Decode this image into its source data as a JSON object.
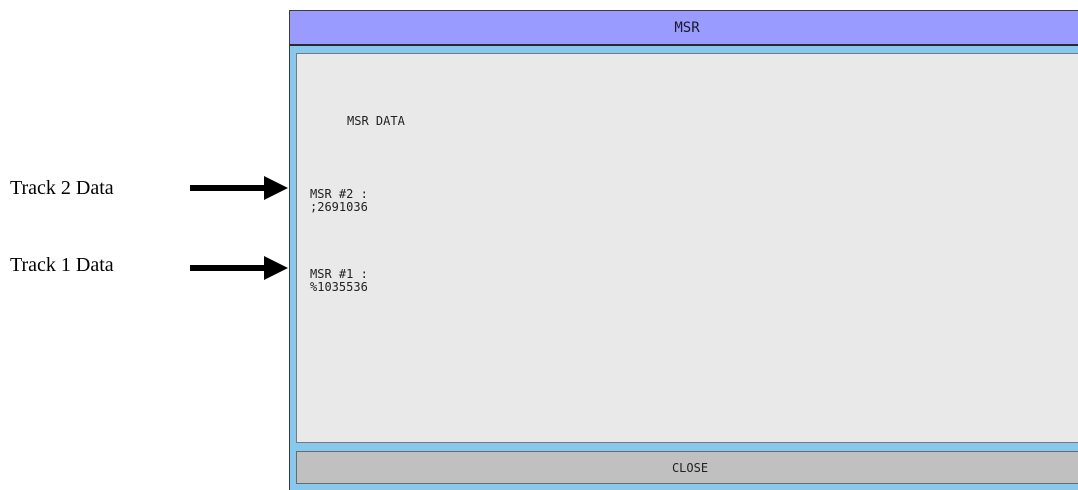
{
  "annotations": {
    "track2": "Track 2 Data",
    "track1": "Track 1 Data"
  },
  "dialog": {
    "title": "MSR",
    "heading": "MSR DATA",
    "msr2_label": "MSR #2 :",
    "msr2_value": ";2691036",
    "msr1_label": "MSR #1 :",
    "msr1_value": "%1035536",
    "close_label": "CLOSE"
  },
  "colors": {
    "titlebar": "#9a9bff",
    "frame": "#86c8ee",
    "content": "#e9e9e9",
    "button": "#c0c0c0"
  }
}
